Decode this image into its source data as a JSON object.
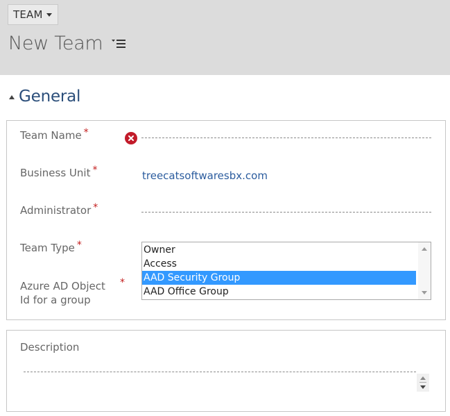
{
  "header": {
    "entity_label": "TEAM",
    "page_title": "New Team",
    "menu_icon": "list-menu-icon",
    "background": "#dcdcdc"
  },
  "section": {
    "title": "General",
    "title_color": "#2b4e7a"
  },
  "form": {
    "team_name": {
      "label": "Team Name",
      "required_mark": "*",
      "value": "",
      "error_icon": "error-x-icon"
    },
    "business_unit": {
      "label": "Business Unit",
      "required_mark": "*",
      "value": "treecatsoftwaresbx.com"
    },
    "administrator": {
      "label": "Administrator",
      "required_mark": "*",
      "value": ""
    },
    "team_type": {
      "label": "Team Type",
      "required_mark": "*",
      "options": [
        "Owner",
        "Access",
        "AAD Security Group",
        "AAD Office Group"
      ],
      "selected": "AAD Security Group"
    },
    "azure_ad": {
      "label_line1": "Azure AD Object",
      "label_line2": "Id for a group",
      "required_mark": "*"
    }
  },
  "description": {
    "label": "Description",
    "value": ""
  },
  "colors": {
    "required": "#c31d1d",
    "link": "#2b5c9e",
    "selection": "#3399ff",
    "error": "#c21b2a"
  }
}
